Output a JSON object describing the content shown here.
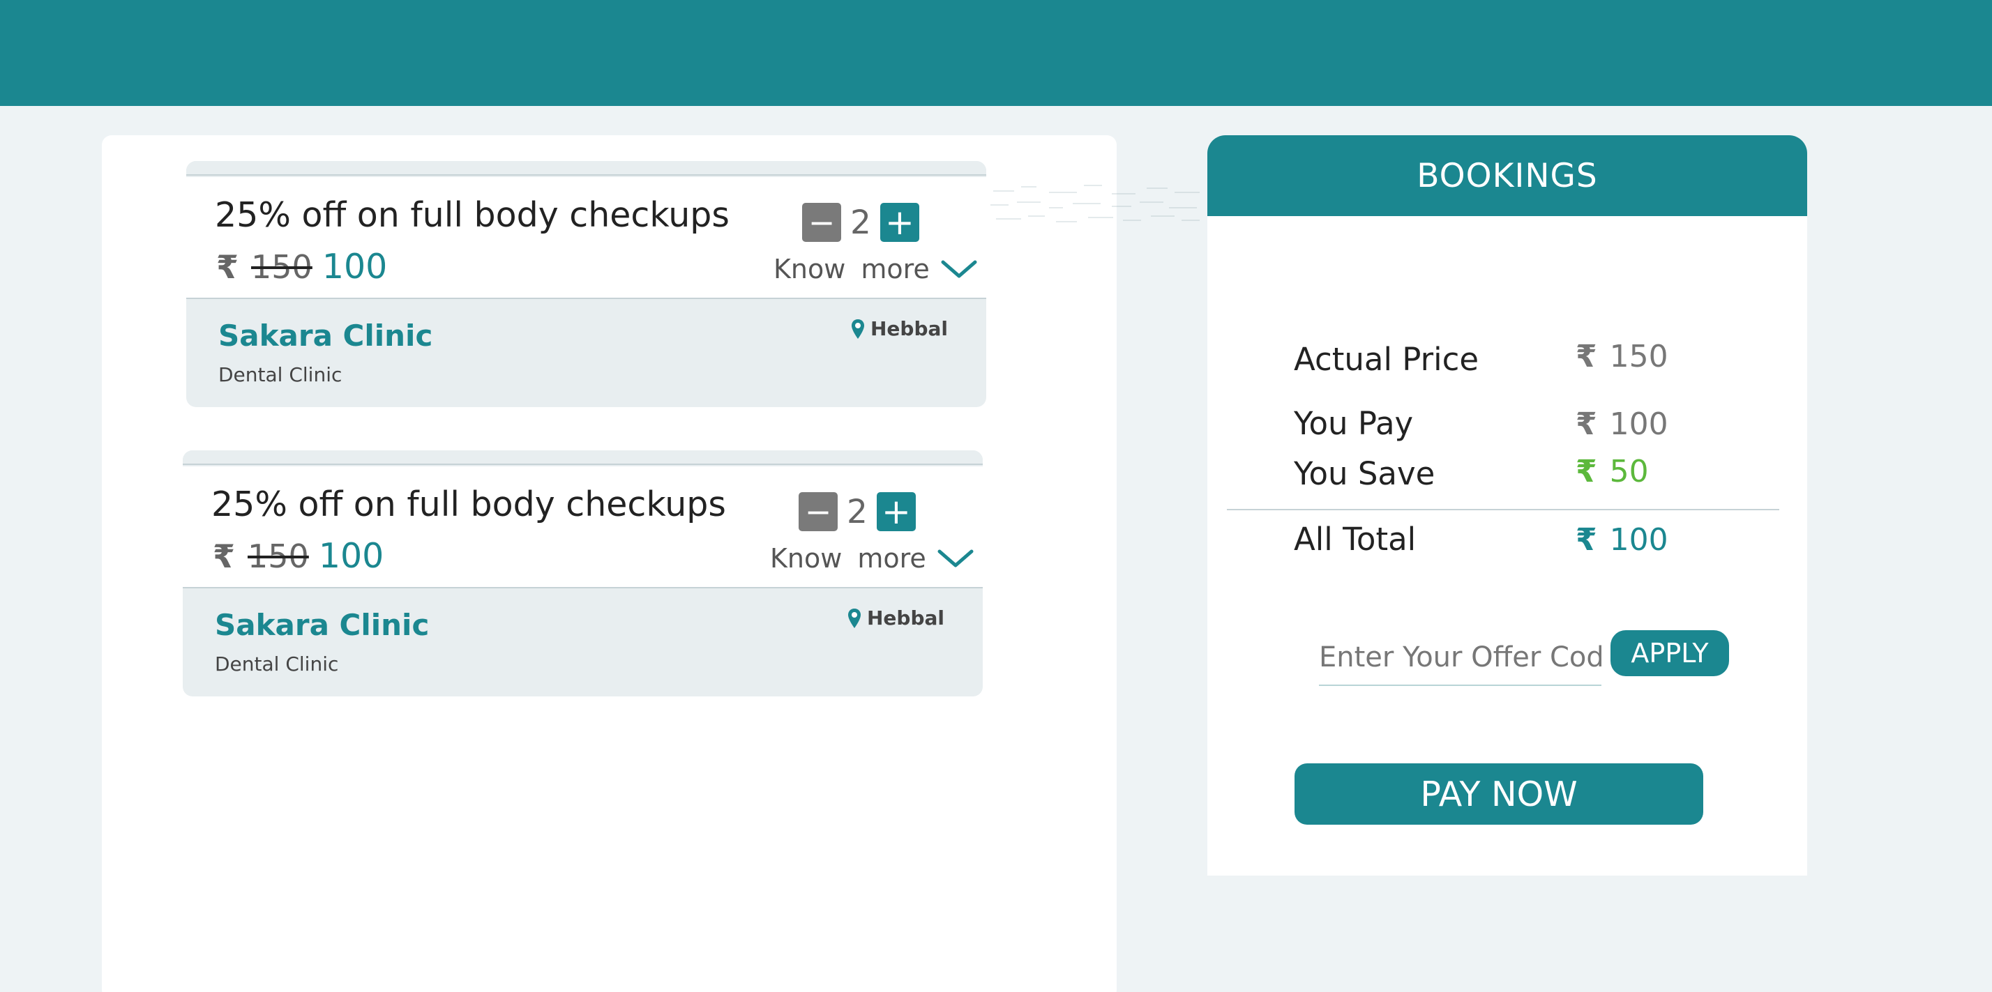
{
  "colors": {
    "accent": "#1b8790",
    "background": "#eef3f5",
    "save_green": "#5cb83c",
    "grey_button": "#7a7a7a"
  },
  "currency_symbol": "₹",
  "deals": [
    {
      "title": "25% off on full body checkups",
      "old_price": "150",
      "new_price": "100",
      "quantity": "2",
      "minus_label": "−",
      "plus_label": "+",
      "know_word": "Know",
      "more_word": "more",
      "clinic_name": "Sakara Clinic",
      "clinic_type": "Dental Clinic",
      "location": "Hebbal"
    },
    {
      "title": "25% off on full body checkups",
      "old_price": "150",
      "new_price": "100",
      "quantity": "2",
      "minus_label": "−",
      "plus_label": "+",
      "know_word": "Know",
      "more_word": "more",
      "clinic_name": "Sakara Clinic",
      "clinic_type": "Dental Clinic",
      "location": "Hebbal"
    }
  ],
  "bookings": {
    "title": "BOOKINGS",
    "actual_price_label": "Actual Price",
    "actual_price_value": "150",
    "you_pay_label": "You Pay",
    "you_pay_value": "100",
    "you_save_label": "You Save",
    "you_save_value": "50",
    "all_total_label": "All Total",
    "all_total_value": "100",
    "offer_placeholder": "Enter Your Offer Code",
    "apply_label": "APPLY",
    "pay_label": "PAY NOW"
  }
}
